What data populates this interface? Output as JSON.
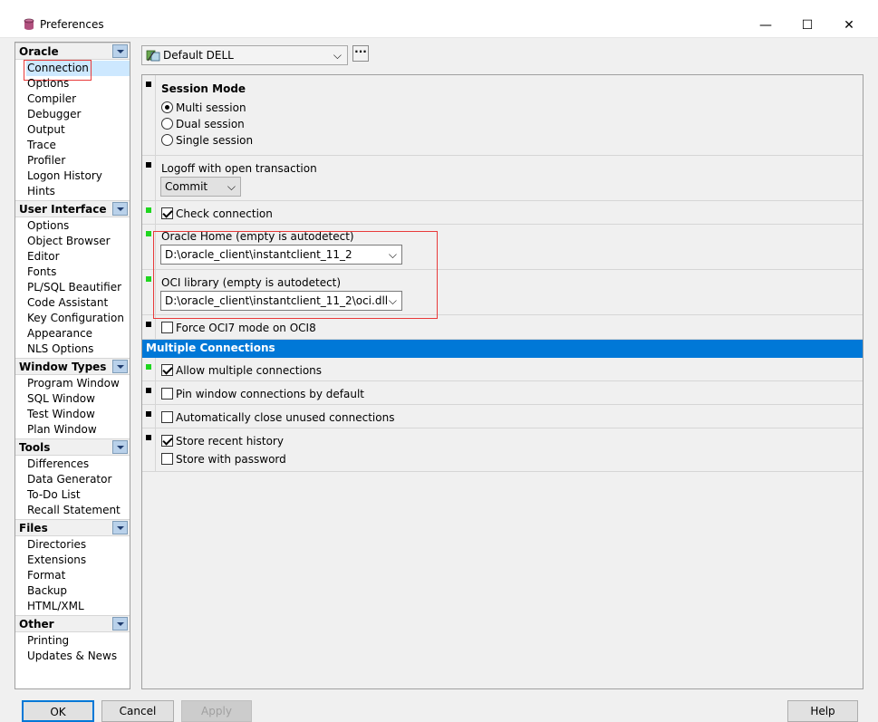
{
  "window": {
    "title": "Preferences",
    "minimize": "—",
    "maximize": "☐",
    "close": "✕"
  },
  "sidebar": {
    "groups": [
      {
        "label": "Oracle",
        "items": [
          "Connection",
          "Options",
          "Compiler",
          "Debugger",
          "Output",
          "Trace",
          "Profiler",
          "Logon History",
          "Hints"
        ]
      },
      {
        "label": "User Interface",
        "items": [
          "Options",
          "Object Browser",
          "Editor",
          "Fonts",
          "PL/SQL Beautifier",
          "Code Assistant",
          "Key Configuration",
          "Appearance",
          "NLS Options"
        ]
      },
      {
        "label": "Window Types",
        "items": [
          "Program Window",
          "SQL Window",
          "Test Window",
          "Plan Window"
        ]
      },
      {
        "label": "Tools",
        "items": [
          "Differences",
          "Data Generator",
          "To-Do List",
          "Recall Statement"
        ]
      },
      {
        "label": "Files",
        "items": [
          "Directories",
          "Extensions",
          "Format",
          "Backup",
          "HTML/XML"
        ]
      },
      {
        "label": "Other",
        "items": [
          "Printing",
          "Updates & News"
        ]
      }
    ],
    "selected": "Connection"
  },
  "toolbar": {
    "profile": "Default DELL",
    "profile_arrow": "⌵",
    "more": "···"
  },
  "session_mode": {
    "title": "Session Mode",
    "options": [
      "Multi session",
      "Dual session",
      "Single session"
    ],
    "selected": "Multi session"
  },
  "logoff": {
    "label": "Logoff with open transaction",
    "value": "Commit",
    "arrow": "⌵"
  },
  "check_connection": {
    "label": "Check connection",
    "checked": true
  },
  "oracle_home": {
    "label": "Oracle Home (empty is autodetect)",
    "value": "D:\\oracle_client\\instantclient_11_2",
    "arrow": "⌵"
  },
  "oci_library": {
    "label": "OCI library (empty is autodetect)",
    "value": "D:\\oracle_client\\instantclient_11_2\\oci.dll",
    "arrow": "⌵"
  },
  "force_oci7": {
    "label": "Force OCI7 mode on OCI8",
    "checked": false
  },
  "multiple_connections": {
    "header": "Multiple Connections",
    "allow": {
      "label": "Allow multiple connections",
      "checked": true
    },
    "pin": {
      "label": "Pin window connections by default",
      "checked": false
    },
    "auto_close": {
      "label": "Automatically close unused connections",
      "checked": false
    },
    "store_history": {
      "label": "Store recent history",
      "checked": true
    },
    "store_password": {
      "label": "Store with password",
      "checked": false
    }
  },
  "buttons": {
    "ok": "OK",
    "cancel": "Cancel",
    "apply": "Apply",
    "help": "Help"
  },
  "colors": {
    "accent": "#0078d7",
    "highlight": "#e83a3a",
    "marker_green": "#1fd61f"
  }
}
